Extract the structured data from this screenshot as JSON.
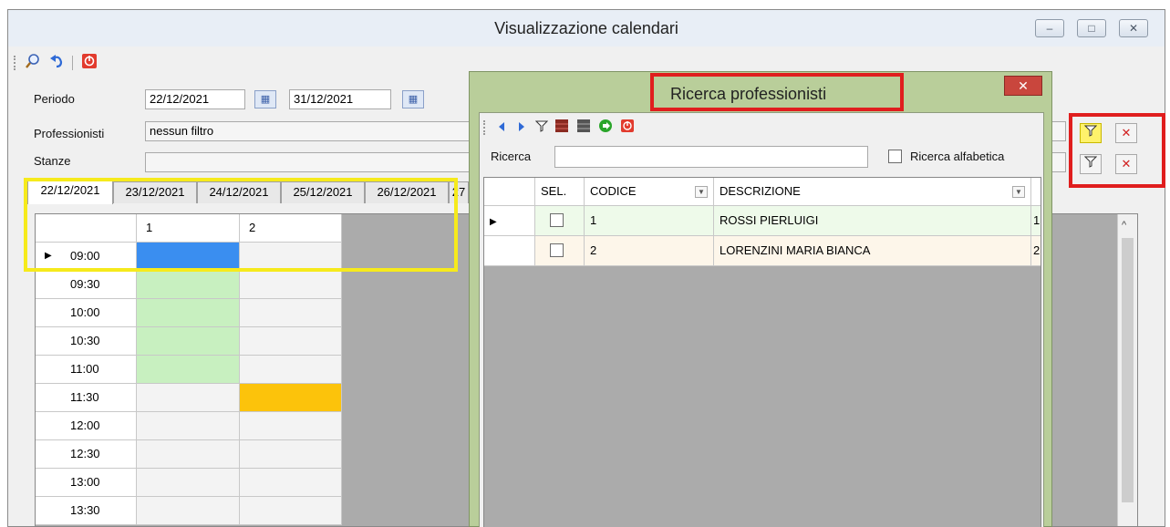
{
  "window": {
    "title": "Visualizzazione calendari",
    "minimize_glyph": "–",
    "restore_glyph": "□",
    "close_glyph": "✕"
  },
  "toolbar": {
    "icons": [
      "search-icon",
      "undo-icon",
      "exit-icon"
    ]
  },
  "form": {
    "periodo_label": "Periodo",
    "periodo_from": "22/12/2021",
    "periodo_to": "31/12/2021",
    "professionisti_label": "Professionisti",
    "professionisti_value": "nessun filtro",
    "stanze_label": "Stanze",
    "stanze_value": ""
  },
  "tabs": [
    "22/12/2021",
    "23/12/2021",
    "24/12/2021",
    "25/12/2021",
    "26/12/2021",
    "27"
  ],
  "calendar": {
    "columns": [
      "1",
      "2"
    ],
    "times": [
      "09:00",
      "09:30",
      "10:00",
      "10:30",
      "11:00",
      "11:30",
      "12:00",
      "12:30",
      "13:00",
      "13:30"
    ],
    "row_marker": "▶",
    "colors": {
      "selected": "#3a8ef0",
      "booked_green": "#c8f0c0",
      "booked_orange": "#fcc30b",
      "empty": "#f3f3f3"
    }
  },
  "dialog": {
    "title": "Ricerca professionisti",
    "close_glyph": "✕",
    "search_label": "Ricerca",
    "search_value": "",
    "alpha_label": "Ricerca alfabetica",
    "alpha_checked": false,
    "headers": {
      "sel": "SEL.",
      "codice": "CODICE",
      "descrizione": "DESCRIZIONE"
    },
    "rows": [
      {
        "codice": "1",
        "descrizione": "ROSSI PIERLUIGI",
        "extra": "1",
        "bg": "#eefaea"
      },
      {
        "codice": "2",
        "descrizione": "LORENZINI MARIA BIANCA",
        "extra": "2",
        "bg": "#fdf6ea"
      }
    ],
    "toolbar_icons": [
      "prev-icon",
      "next-icon",
      "filter-icon",
      "grid-icon",
      "grid-dark-icon",
      "confirm-icon",
      "exit-icon"
    ]
  },
  "highlight_colors": {
    "yellow": "#f6ea1c",
    "red": "#e01e1e"
  }
}
